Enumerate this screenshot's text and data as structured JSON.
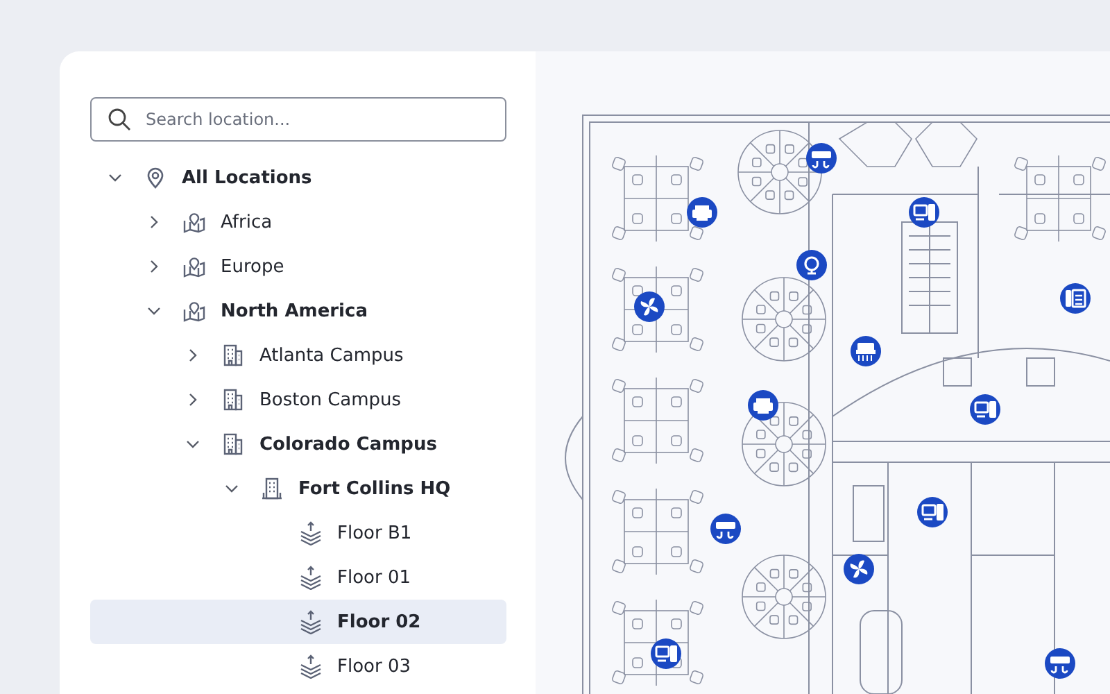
{
  "search": {
    "placeholder": "Search location..."
  },
  "tree": [
    {
      "label": "All Locations",
      "kind": "location",
      "expanded": true,
      "selected": false,
      "children": [
        {
          "label": "Africa",
          "kind": "region",
          "expanded": false,
          "selected": false
        },
        {
          "label": "Europe",
          "kind": "region",
          "expanded": false,
          "selected": false
        },
        {
          "label": "North America",
          "kind": "region",
          "expanded": true,
          "selected": false,
          "children": [
            {
              "label": "Atlanta Campus",
              "kind": "campus",
              "expanded": false,
              "selected": false
            },
            {
              "label": "Boston Campus",
              "kind": "campus",
              "expanded": false,
              "selected": false
            },
            {
              "label": "Colorado Campus",
              "kind": "campus",
              "expanded": true,
              "selected": false,
              "children": [
                {
                  "label": "Fort Collins HQ",
                  "kind": "building",
                  "expanded": true,
                  "selected": false,
                  "children": [
                    {
                      "label": "Floor B1",
                      "kind": "floor",
                      "selected": false
                    },
                    {
                      "label": "Floor 01",
                      "kind": "floor",
                      "selected": false
                    },
                    {
                      "label": "Floor 02",
                      "kind": "floor",
                      "selected": true
                    },
                    {
                      "label": "Floor 03",
                      "kind": "floor",
                      "selected": false
                    }
                  ]
                }
              ]
            }
          ]
        }
      ]
    }
  ]
}
